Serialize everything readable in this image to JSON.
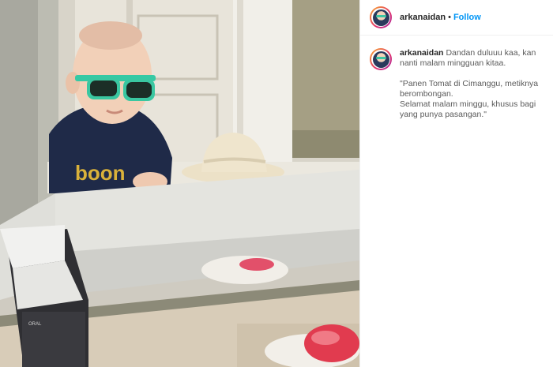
{
  "post": {
    "author": {
      "username": "arkanaidan",
      "separator": "•",
      "follow_label": "Follow"
    },
    "caption": {
      "username": "arkanaidan",
      "first_line": "Dandan duluuu kaa, kan nanti malam mingguan kitaa.",
      "quote_line_1": "\"Panen Tomat di Cimanggu, metiknya berombongan.",
      "quote_line_2": "Selamat malam minggu, khusus bagi yang punya pasangan.\""
    },
    "photo": {
      "shirt_text": "boon",
      "box_label": "ORAL"
    }
  }
}
